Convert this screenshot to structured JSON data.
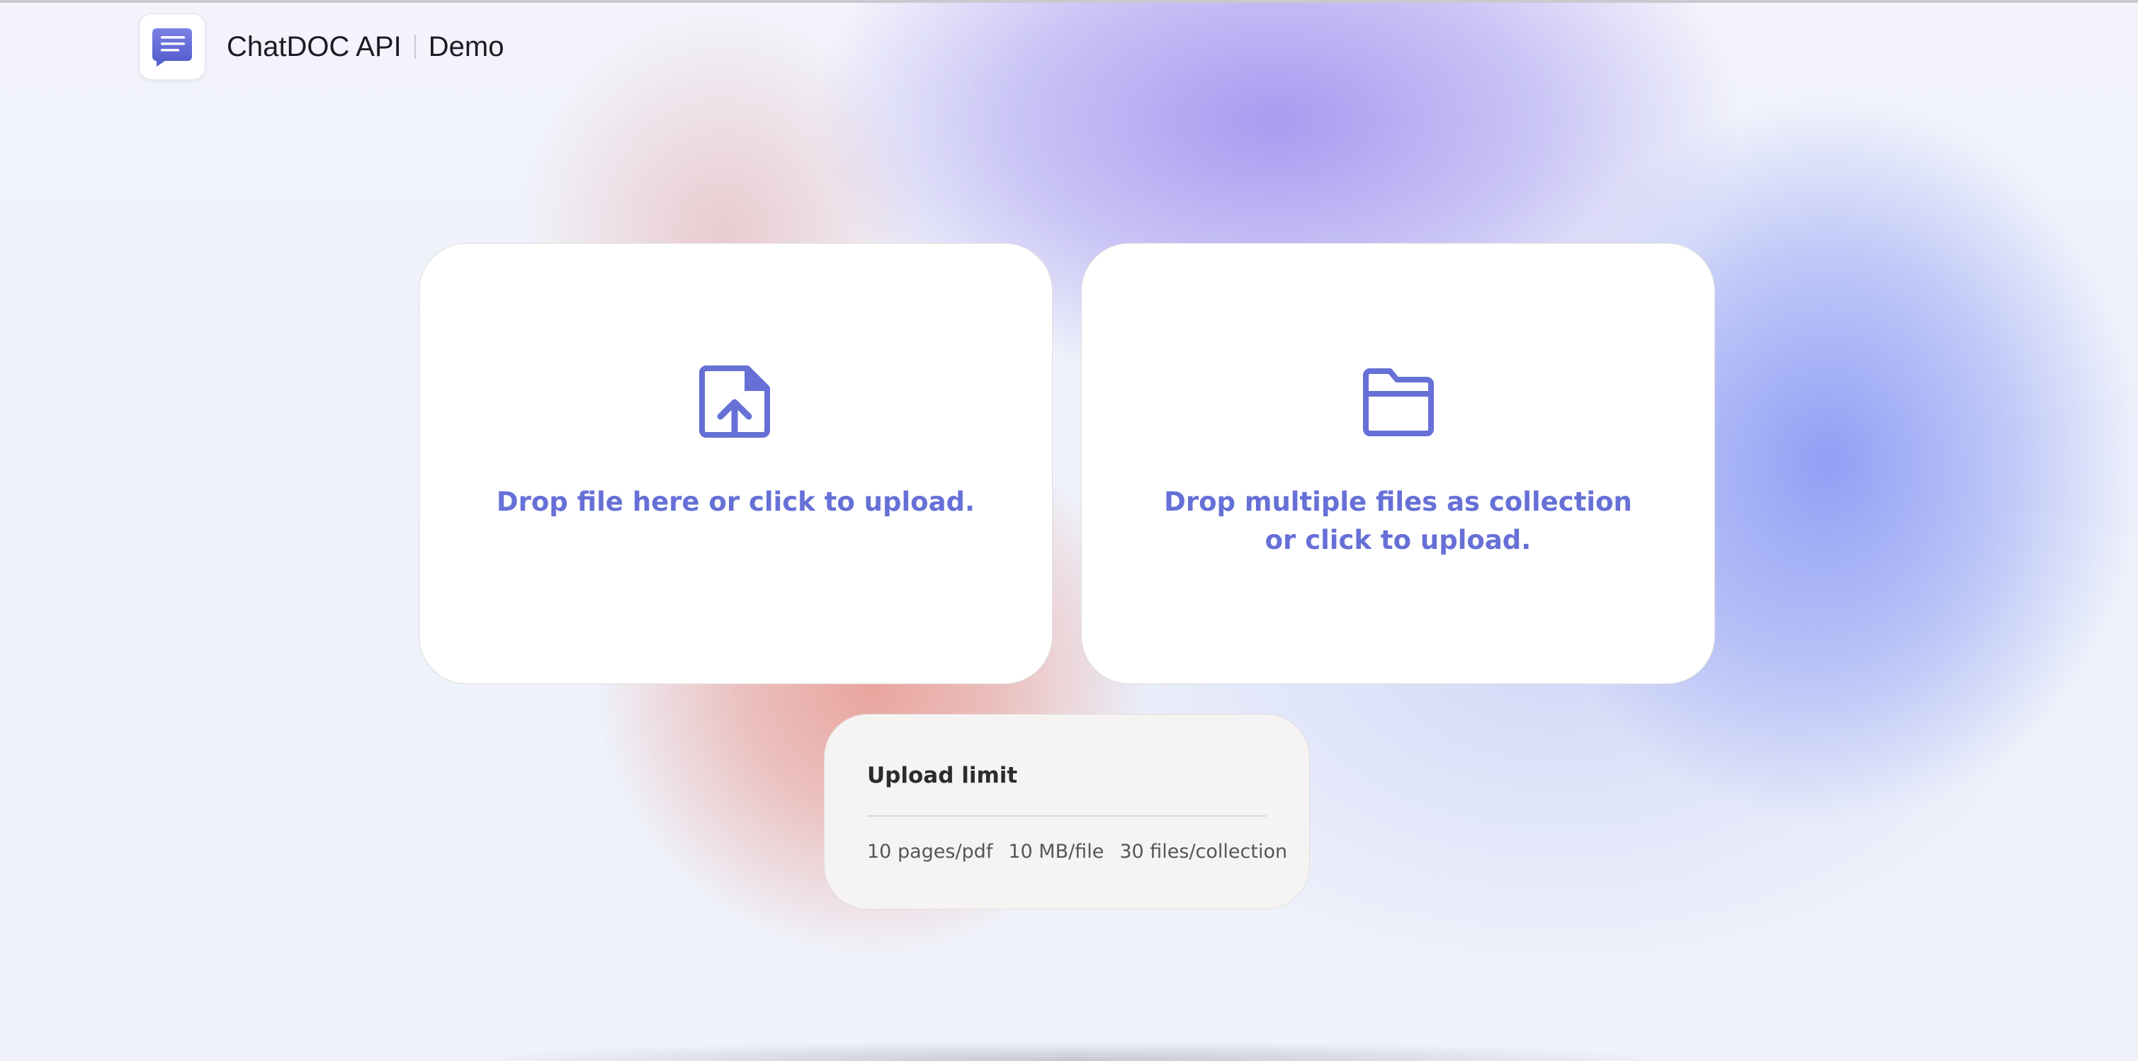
{
  "header": {
    "brand_name": "ChatDOC API",
    "brand_suffix": "Demo"
  },
  "upload_single": {
    "icon": "file-upload-icon",
    "label": "Drop file here or click to upload."
  },
  "upload_collection": {
    "icon": "folder-icon",
    "label_line1": "Drop multiple files as collection",
    "label_line2": "or click to upload."
  },
  "upload_limit": {
    "title": "Upload limit",
    "items": [
      "10 pages/pdf",
      "10 MB/file",
      "30 files/collection"
    ]
  },
  "colors": {
    "accent": "#6670d6",
    "logo_gradient_start": "#7b82e6",
    "logo_gradient_end": "#4f59c9"
  }
}
